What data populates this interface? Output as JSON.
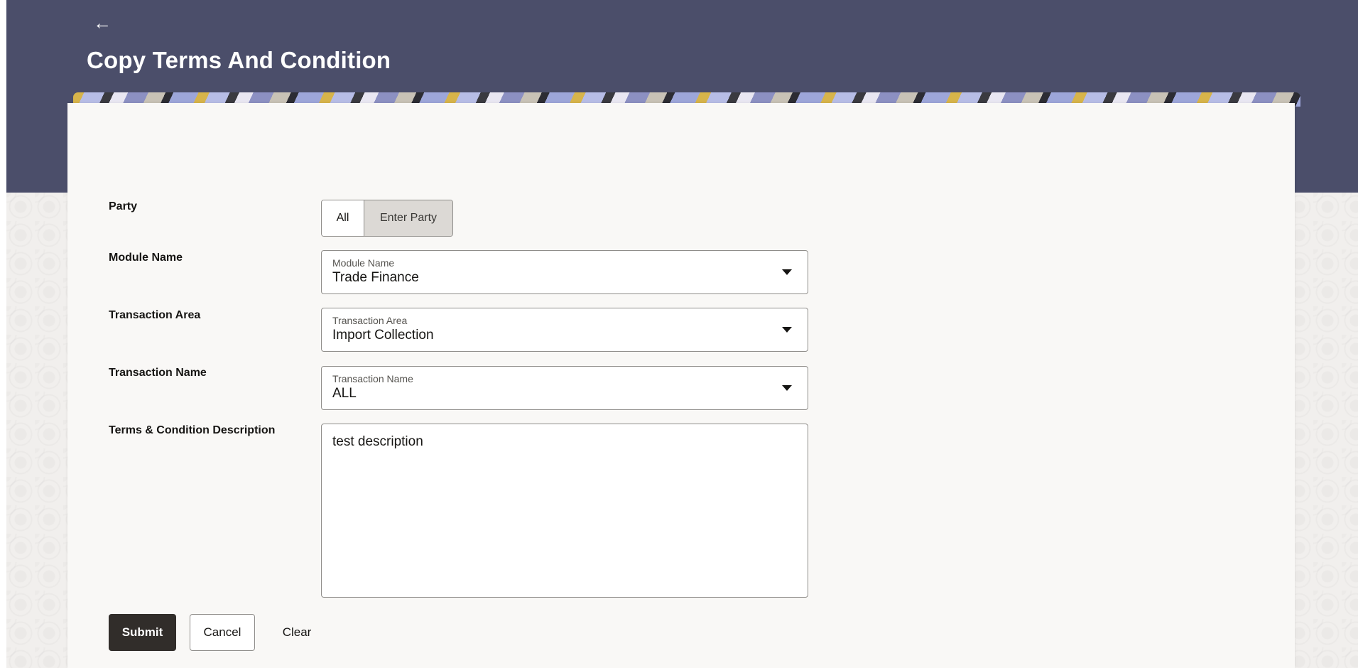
{
  "header": {
    "back_icon": "back-arrow-icon",
    "back_glyph": "←",
    "title": "Copy Terms And Condition",
    "background_color": "#4b4e6a"
  },
  "form": {
    "party": {
      "label": "Party",
      "options": [
        "All",
        "Enter Party"
      ],
      "selected": "Enter Party"
    },
    "module_name": {
      "label": "Module Name",
      "field_label": "Module Name",
      "value": "Trade Finance",
      "icon": "caret-down-icon"
    },
    "transaction_area": {
      "label": "Transaction Area",
      "field_label": "Transaction Area",
      "value": "Import Collection",
      "icon": "caret-down-icon"
    },
    "transaction_name": {
      "label": "Transaction Name",
      "field_label": "Transaction Name",
      "value": "ALL",
      "icon": "caret-down-icon"
    },
    "description": {
      "label": "Terms & Condition Description",
      "value": "test description"
    }
  },
  "actions": {
    "submit": "Submit",
    "cancel": "Cancel",
    "clear": "Clear",
    "primary_color": "#312d2a"
  }
}
